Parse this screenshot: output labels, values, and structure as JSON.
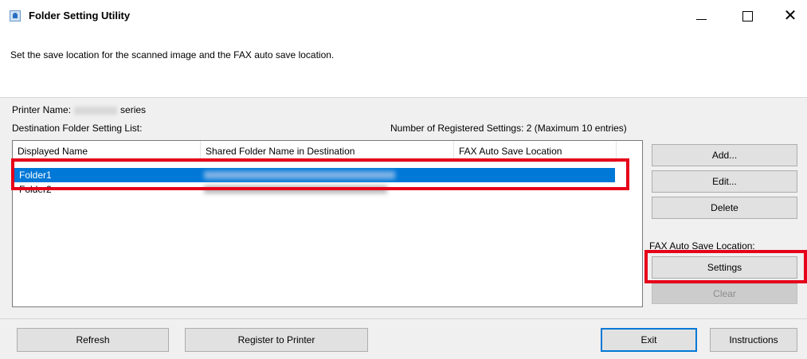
{
  "window": {
    "title": "Folder Setting Utility",
    "controls": {
      "minimize": "–",
      "maximize": "☐",
      "close": "✕"
    }
  },
  "instruction": "Set the save location for the scanned image and the FAX auto save location.",
  "printer": {
    "label": "Printer Name:",
    "suffix": "series"
  },
  "destination_list": {
    "label": "Destination Folder Setting List:",
    "count_text": "Number of Registered Settings: 2 (Maximum 10 entries)",
    "columns": [
      "Displayed Name",
      "Shared Folder Name in Destination",
      "FAX Auto Save Location"
    ],
    "rows": [
      {
        "name": "Folder1",
        "selected": true
      },
      {
        "name": "Folder2",
        "selected": false
      }
    ]
  },
  "side_buttons": {
    "add": "Add...",
    "edit": "Edit...",
    "delete": "Delete"
  },
  "fax": {
    "label": "FAX Auto Save Location:",
    "settings": "Settings",
    "clear": "Clear"
  },
  "bottom_buttons": {
    "refresh": "Refresh",
    "register": "Register to Printer",
    "exit": "Exit",
    "instructions": "Instructions"
  },
  "colors": {
    "selection": "#0078d7",
    "highlight_frame": "#e6001a"
  }
}
